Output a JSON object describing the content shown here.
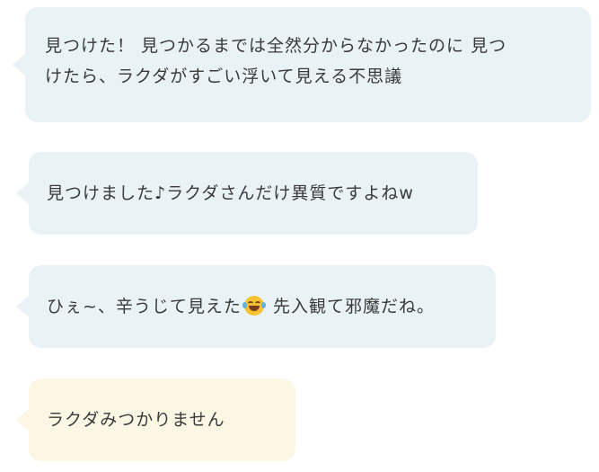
{
  "messages": [
    {
      "text_line1": "見つけた！ 見つかるまでは全然分からなかったのに 見つ",
      "text_line2": "けたら、ラクダがすごい浮いて見える不思議",
      "color": "#e9f2f4"
    },
    {
      "text": "見つけました♪ラクダさんだけ異質ですよねw",
      "color": "#e9f2f4"
    },
    {
      "text_before": "ひぇ~、辛うじて見えた",
      "emoji": "face-with-tears-of-joy-icon",
      "text_after": " 先入観て邪魔だね。",
      "color": "#e9f2f4"
    },
    {
      "text": "ラクダみつかりません",
      "color": "#fbf7e4"
    }
  ]
}
